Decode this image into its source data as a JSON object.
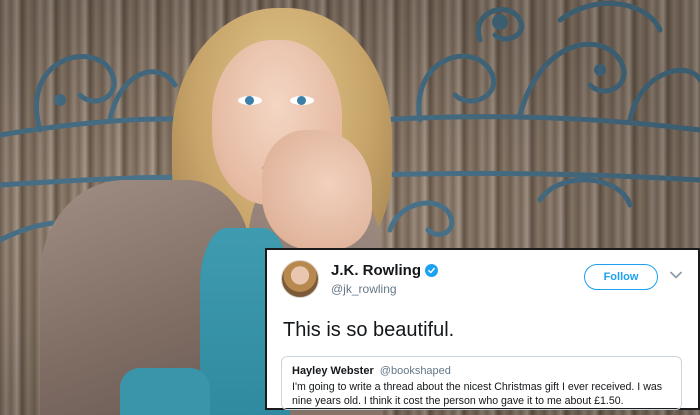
{
  "tweet": {
    "display_name": "J.K. Rowling",
    "handle": "@jk_rowling",
    "follow_label": "Follow",
    "text": "This is so beautiful.",
    "verified": true,
    "accent_color": "#1da1f2",
    "quote": {
      "name": "Hayley Webster",
      "handle": "@bookshaped",
      "text": "I'm going to write a thread about the nicest Christmas gift I ever received. I was nine years old. I think it cost the person who gave it to me about £1.50."
    }
  },
  "icons": {
    "verified": "verified-badge-icon",
    "menu": "chevron-down-icon"
  }
}
